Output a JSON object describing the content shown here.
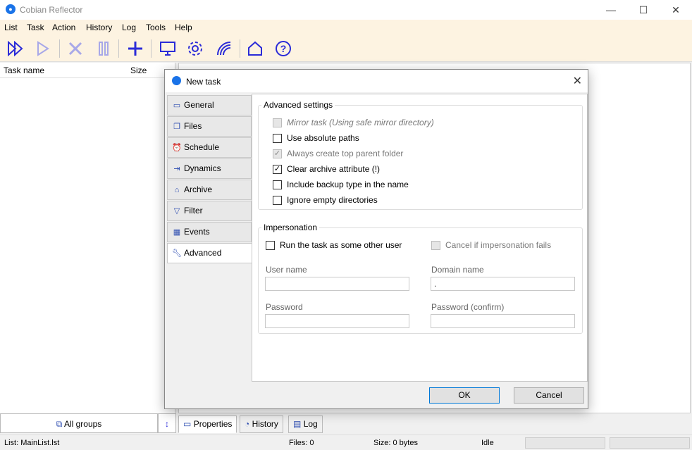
{
  "window": {
    "title": "Cobian Reflector",
    "minimize": "—",
    "maximize": "☐",
    "close": "✕"
  },
  "menu": [
    "List",
    "Task",
    "Action",
    "History",
    "Log",
    "Tools",
    "Help"
  ],
  "toolbar": {
    "icons": [
      "run-all-icon",
      "run-selected-icon",
      "stop-icon",
      "pause-icon",
      "add-task-icon",
      "monitor-icon",
      "settings-icon",
      "network-icon",
      "home-icon",
      "help-icon"
    ],
    "accent_color": "#2b2bd8"
  },
  "tasklist": {
    "col_name": "Task name",
    "col_size": "Size"
  },
  "bottom": {
    "groups_label": "All groups",
    "tabs": [
      "Properties",
      "History",
      "Log"
    ]
  },
  "status": {
    "list": "List: MainList.lst",
    "files": "Files: 0",
    "size": "Size: 0 bytes",
    "state": "Idle"
  },
  "dialog": {
    "title": "New task",
    "close": "✕",
    "tabs": [
      {
        "label": "General",
        "icon": "monitor-icon"
      },
      {
        "label": "Files",
        "icon": "files-icon"
      },
      {
        "label": "Schedule",
        "icon": "alarm-clock-icon"
      },
      {
        "label": "Dynamics",
        "icon": "dynamics-icon"
      },
      {
        "label": "Archive",
        "icon": "archive-icon"
      },
      {
        "label": "Filter",
        "icon": "filter-icon"
      },
      {
        "label": "Events",
        "icon": "calendar-icon"
      },
      {
        "label": "Advanced",
        "icon": "wrench-icon"
      }
    ],
    "active_tab": "Advanced",
    "advanced": {
      "title": "Advanced settings",
      "options": [
        {
          "label": "Mirror task (Using safe mirror directory)",
          "checked": false,
          "enabled": false
        },
        {
          "label": "Use absolute paths",
          "checked": false,
          "enabled": true
        },
        {
          "label": "Always create top parent folder",
          "checked": true,
          "enabled": false
        },
        {
          "label": "Clear archive attribute (!)",
          "checked": true,
          "enabled": true
        },
        {
          "label": "Include backup type in the name",
          "checked": false,
          "enabled": true
        },
        {
          "label": "Ignore empty directories",
          "checked": false,
          "enabled": true
        }
      ]
    },
    "impersonation": {
      "title": "Impersonation",
      "run_as_other": "Run the task as some other user",
      "cancel_if_fails": "Cancel if impersonation fails",
      "user_name_label": "User name",
      "user_name_value": "",
      "domain_name_label": "Domain name",
      "domain_name_value": ".",
      "password_label": "Password",
      "password_value": "",
      "password_confirm_label": "Password (confirm)",
      "password_confirm_value": ""
    },
    "ok": "OK",
    "cancel": "Cancel"
  }
}
